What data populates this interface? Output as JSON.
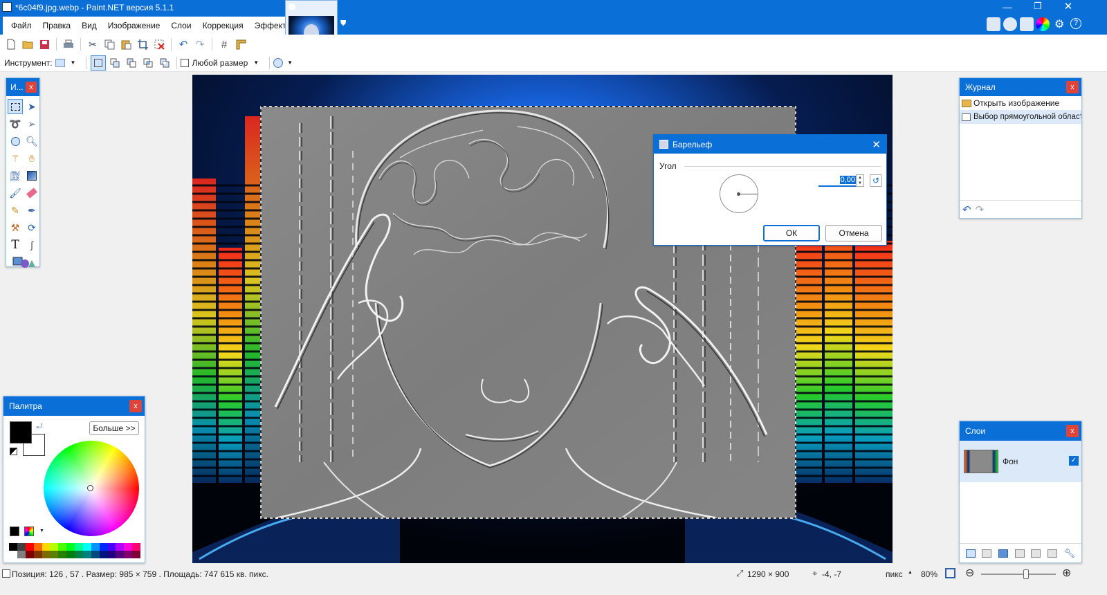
{
  "window": {
    "title": "*6c04f9.jpg.webp - Paint.NET версия 5.1.1"
  },
  "menu": [
    "Файл",
    "Правка",
    "Вид",
    "Изображение",
    "Слои",
    "Коррекция",
    "Эффекты"
  ],
  "toolbar2": {
    "tool_label": "Инструмент:",
    "size_label": "Любой размер"
  },
  "tools_panel": {
    "title": "И...",
    "close": "x"
  },
  "palette_panel": {
    "title": "Палитра",
    "close": "x",
    "more_button": "Больше >>"
  },
  "history_panel": {
    "title": "Журнал",
    "close": "x",
    "items": [
      {
        "label": "Открыть изображение",
        "icon": "folder-icon"
      },
      {
        "label": "Выбор прямоугольной области",
        "icon": "rect-select-icon"
      }
    ]
  },
  "layers_panel": {
    "title": "Слои",
    "close": "x",
    "layers": [
      {
        "name": "Фон",
        "visible": true
      }
    ]
  },
  "dialog": {
    "title": "Барельеф",
    "section": "Угол",
    "angle_value": "0,00",
    "angle_degrees": 0,
    "ok": "ОК",
    "cancel": "Отмена"
  },
  "status": {
    "position": "Позиция: 126 , 57 . Размер: 985  × 759 . Площадь: 747 615 кв. пикс.",
    "image_size": "1290 × 900",
    "offset": "-4, -7",
    "units": "пикс",
    "zoom": "80%",
    "zoom_fraction": 0.6
  },
  "colors": {
    "accent": "#0a6fd6",
    "close": "#e0433a",
    "primary_color": "#000000",
    "secondary_color": "#ffffff"
  }
}
